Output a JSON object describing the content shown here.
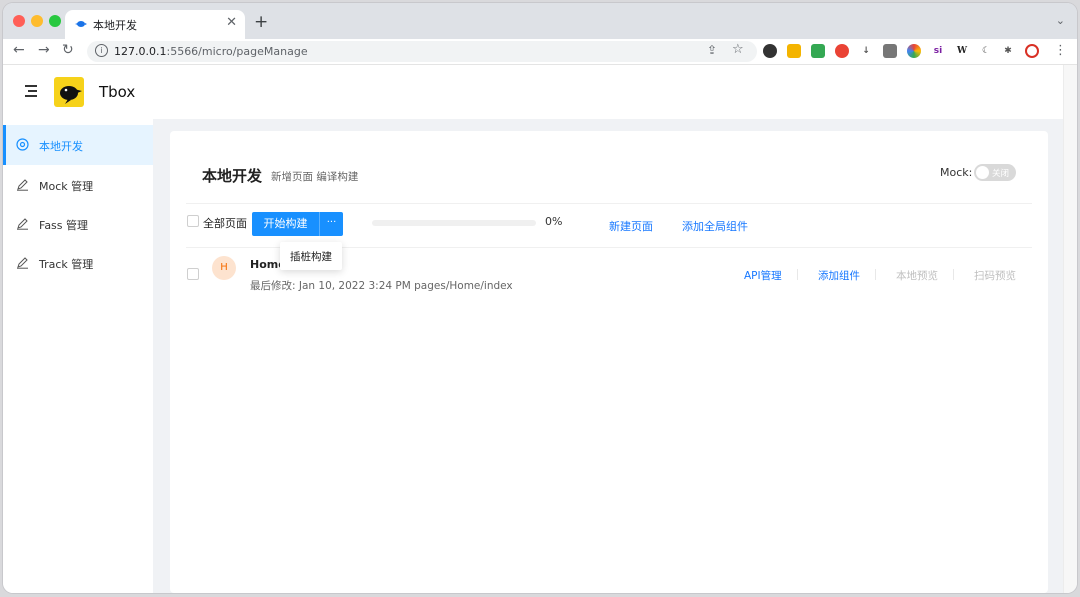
{
  "browser": {
    "tab_title": "本地开发",
    "tab_close": "✕",
    "new_tab": "+",
    "tabs_chevron": "⌄",
    "url_host": "127.0.0.1",
    "url_rest": ":5566/micro/pageManage",
    "nav_back": "←",
    "nav_forward": "→",
    "nav_reload": "↻",
    "share_icon": "⇪",
    "star_icon": "☆",
    "menu_icon": "⋮",
    "extensions": [
      "si",
      "W"
    ]
  },
  "app": {
    "brand": "Tbox"
  },
  "sidebar": {
    "items": [
      {
        "label": "本地开发",
        "icon": "target-icon",
        "active": true
      },
      {
        "label": "Mock 管理",
        "icon": "pencil-icon",
        "active": false
      },
      {
        "label": "Fass 管理",
        "icon": "pencil-icon",
        "active": false
      },
      {
        "label": "Track 管理",
        "icon": "pencil-icon",
        "active": false
      }
    ]
  },
  "main": {
    "title": "本地开发",
    "subtitle": "新增页面 编译构建",
    "mock_label": "Mock:",
    "mock_switch_text": "关闭",
    "mock_enabled": false,
    "select_all_label": "全部页面",
    "build_button": "开始构建",
    "build_more": "···",
    "progress_percent": 0,
    "progress_text": "0%",
    "new_page_link": "新建页面",
    "add_global_component_link": "添加全局组件",
    "dropdown_item": "插桩构建",
    "pages": [
      {
        "avatar": "H",
        "name": "Home",
        "meta": "最后修改: Jan 10, 2022 3:24 PM pages/Home/index",
        "actions": {
          "api": "API管理",
          "add_component": "添加组件",
          "local_preview": "本地预览",
          "scan_preview": "扫码预览"
        }
      }
    ]
  }
}
